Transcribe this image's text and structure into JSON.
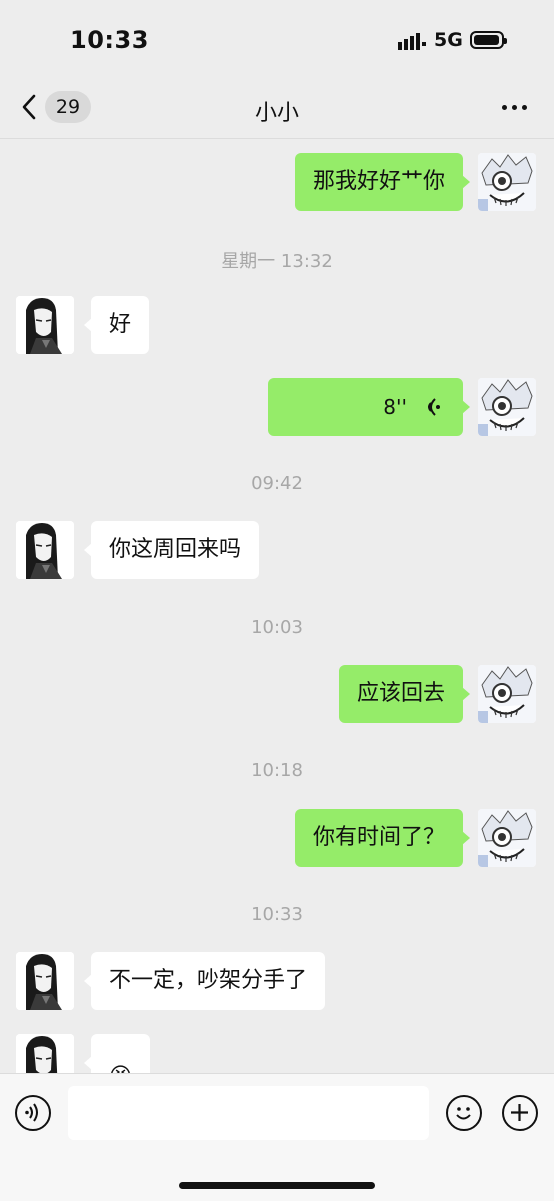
{
  "status_bar": {
    "time": "10:33",
    "network": "5G"
  },
  "nav": {
    "unread_count": "29",
    "title": "小小"
  },
  "messages": [
    {
      "text": "那我好好艹你"
    },
    {
      "text": "星期一 13:32"
    },
    {
      "text": "好"
    },
    {
      "text": "8''"
    },
    {
      "text": "09:42"
    },
    {
      "text": "你这周回来吗"
    },
    {
      "text": "10:03"
    },
    {
      "text": "应该回去"
    },
    {
      "text": "10:18"
    },
    {
      "text": "你有时间了？"
    },
    {
      "text": "10:33"
    },
    {
      "text": "不一定，吵架分手了"
    },
    {
      "text": "😆"
    }
  ],
  "colors": {
    "background": "#ededed",
    "outgoing_bubble": "#95ec69",
    "incoming_bubble": "#ffffff"
  }
}
